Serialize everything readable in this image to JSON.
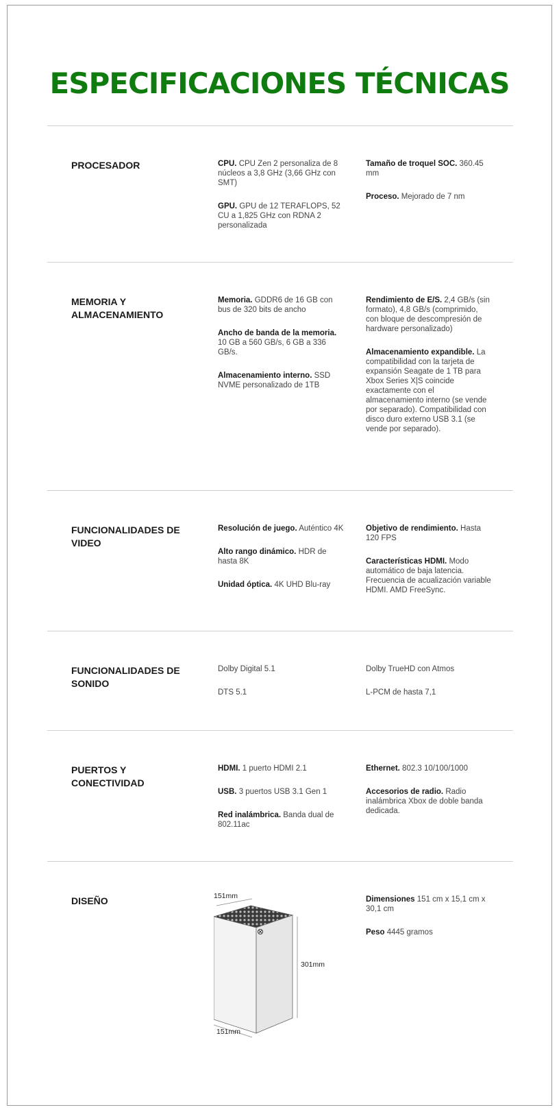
{
  "page": {
    "title": "ESPECIFICACIONES TÉCNICAS",
    "accent_color": "#107c10"
  },
  "sections": {
    "procesador": {
      "title": "PROCESADOR",
      "col2": [
        {
          "label": "CPU.",
          "text": "CPU Zen 2 personaliza de 8 núcleos a 3,8 GHz (3,66 GHz con SMT)"
        },
        {
          "label": "GPU.",
          "text": "GPU de 12 TERAFLOPS, 52 CU a 1,825 GHz con RDNA 2 personalizada"
        }
      ],
      "col3": [
        {
          "label": "Tamaño de troquel SOC.",
          "text": "360.45 mm"
        },
        {
          "label": "Proceso.",
          "text": "Mejorado de 7 nm"
        }
      ]
    },
    "memoria": {
      "title": "MEMORIA Y ALMACENAMIENTO",
      "col2": [
        {
          "label": "Memoria.",
          "text": "GDDR6 de 16 GB con bus de 320 bits de ancho"
        },
        {
          "label": "Ancho de banda de la memoria.",
          "text": "10 GB a 560 GB/s, 6 GB a 336 GB/s."
        },
        {
          "label": "Almacenamiento interno.",
          "text": "SSD NVME personalizado de 1TB"
        }
      ],
      "col3": [
        {
          "label": "Rendimiento de E/S.",
          "text": "2,4 GB/s (sin formato), 4,8 GB/s (comprimido, con bloque de descompresión de hardware personalizado)"
        },
        {
          "label": "Almacenamiento expandible.",
          "text": "La compatibilidad con la tarjeta de expansión Seagate de 1 TB para Xbox Series X|S coincide exactamente con el almacenamiento interno (se vende por separado). Compatibilidad con disco duro externo USB 3.1 (se vende por separado)."
        }
      ]
    },
    "video": {
      "title": "FUNCIONALIDADES DE VIDEO",
      "col2": [
        {
          "label": "Resolución de juego.",
          "text": "Auténtico 4K"
        },
        {
          "label": "Alto rango dinámico.",
          "text": "HDR de hasta 8K"
        },
        {
          "label": "Unidad óptica.",
          "text": "4K UHD Blu-ray"
        }
      ],
      "col3": [
        {
          "label": "Objetivo de rendimiento.",
          "text": "Hasta 120 FPS"
        },
        {
          "label": "Características HDMI.",
          "text": "Modo automático de baja latencia. Frecuencia de acualización variable HDMI. AMD FreeSync."
        }
      ]
    },
    "sonido": {
      "title": "FUNCIONALIDADES DE SONIDO",
      "col2": [
        {
          "label": "",
          "text": "Dolby Digital 5.1"
        },
        {
          "label": "",
          "text": "DTS 5.1"
        }
      ],
      "col3": [
        {
          "label": "",
          "text": "Dolby TrueHD con Atmos"
        },
        {
          "label": "",
          "text": "L-PCM de hasta 7,1"
        }
      ]
    },
    "puertos": {
      "title": "PUERTOS Y CONECTIVIDAD",
      "col2": [
        {
          "label": "HDMI.",
          "text": "1 puerto HDMI 2.1"
        },
        {
          "label": "USB.",
          "text": "3 puertos USB 3.1 Gen 1"
        },
        {
          "label": "Red inalámbrica.",
          "text": "Banda dual de 802.11ac"
        }
      ],
      "col3": [
        {
          "label": "Ethernet.",
          "text": "802.3 10/100/1000"
        },
        {
          "label": "Accesorios de radio.",
          "text": "Radio inalámbrica Xbox de doble banda dedicada."
        }
      ]
    },
    "diseno": {
      "title": "DISEÑO",
      "diagram": {
        "top_label": "151mm",
        "side_label": "301mm",
        "bottom_label": "151mm",
        "icon": "xbox-console-icon"
      },
      "col3": [
        {
          "label": "Dimensiones",
          "text": "151 cm x 15,1 cm x 30,1 cm"
        },
        {
          "label": "Peso",
          "text": "4445 gramos"
        }
      ]
    }
  }
}
